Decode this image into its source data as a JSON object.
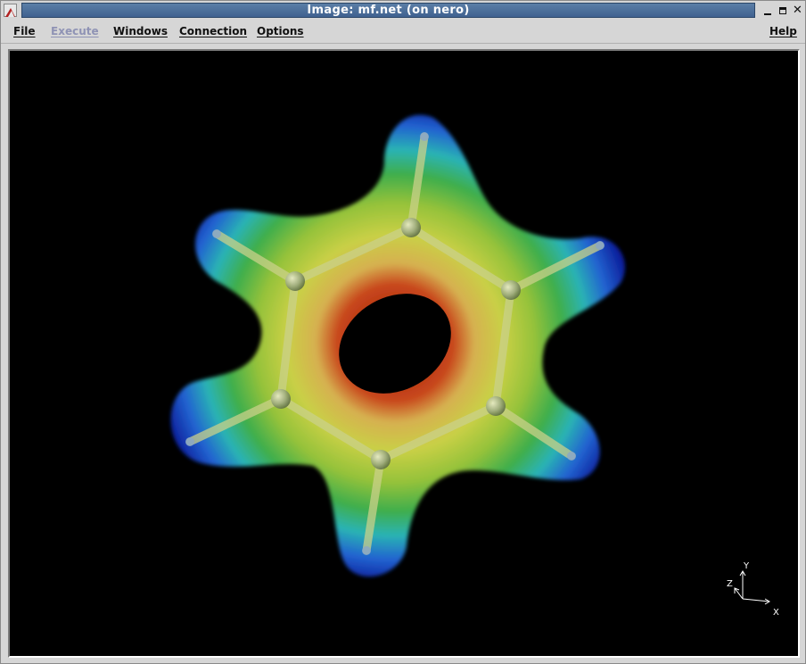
{
  "window": {
    "title": "Image: mf.net (on nero)"
  },
  "menubar": {
    "items": [
      {
        "id": "file",
        "label": "File",
        "enabled": true
      },
      {
        "id": "execute",
        "label": "Execute",
        "enabled": false
      },
      {
        "id": "windows",
        "label": "Windows",
        "enabled": true
      },
      {
        "id": "connection",
        "label": "Connection",
        "enabled": true
      },
      {
        "id": "options",
        "label": "Options",
        "enabled": true
      },
      {
        "id": "help",
        "label": "Help",
        "enabled": true
      }
    ]
  },
  "viewport": {
    "background": "#000000",
    "axes": {
      "x": "X",
      "y": "Y",
      "z": "Z"
    }
  },
  "icons": {
    "app": "app-menu-icon",
    "minimize": "minimize-icon",
    "maximize": "maximize-icon",
    "close": "close-icon"
  },
  "colors": {
    "titlebar": "#4a6d99",
    "menu_disabled": "#8f93b5",
    "surface_low": "#1a4fc4",
    "surface_mid": "#7fc23a",
    "surface_high": "#b8361a"
  }
}
